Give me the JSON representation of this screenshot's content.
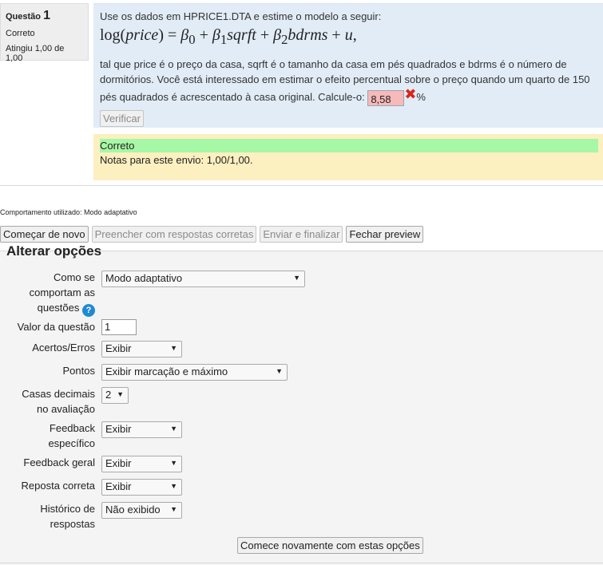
{
  "question_info": {
    "label": "Questão",
    "number": "1",
    "state": "Correto",
    "grade": "Atingiu 1,00 de 1,00"
  },
  "formulation": {
    "intro": "Use os dados em HPRICE1.DTA e estime o modelo a seguir:",
    "formula": "log(price) = β0 + β1sqrft + β2bdrms + u,",
    "text": "tal que price é o preço da casa, sqrft é o tamanho da casa em pés quadrados e bdrms é o número de dormitórios. Você está interessado em estimar o efeito percentual sobre o preço quando um quarto de 150 pés quadrados é acrescentado à casa original. Calcule-o:",
    "answer_value": "8,58",
    "unit": "%",
    "check_button": "Verificar"
  },
  "outcome": {
    "correctness": "Correto",
    "grades": "Notas para este envio: 1,00/1,00."
  },
  "behaviour_text": "Comportamento utilizado: Modo adaptativo",
  "controls": {
    "restart": "Começar de novo",
    "fill_correct": "Preencher com respostas corretas",
    "submit_finish": "Enviar e finalizar",
    "close_preview": "Fechar preview"
  },
  "options": {
    "legend": "Alterar opções",
    "behaviour_label": "Como se comportam as questões",
    "behaviour_value": "Modo adaptativo",
    "mark_label": "Valor da questão",
    "mark_value": "1",
    "correctness_label": "Acertos/Erros",
    "correctness_value": "Exibir",
    "marks_label": "Pontos",
    "marks_value": "Exibir marcação e máximo",
    "decimals_label": "Casas decimais no avaliação",
    "decimals_value": "2",
    "feedback_label": "Feedback específico",
    "feedback_value": "Exibir",
    "general_feedback_label": "Feedback geral",
    "general_feedback_value": "Exibir",
    "right_answer_label": "Reposta correta",
    "right_answer_value": "Exibir",
    "history_label": "Histórico de respostas",
    "history_value": "Não exibido",
    "restart_button": "Comece novamente com estas opções"
  },
  "colors": {
    "formulation_bg": "#e1ecf7",
    "outcome_bg": "#fcefc0",
    "correct_bg": "#a6f7a6",
    "incorrect_input_bg": "#f7b9b9",
    "help_icon": "#1f8ad3"
  }
}
